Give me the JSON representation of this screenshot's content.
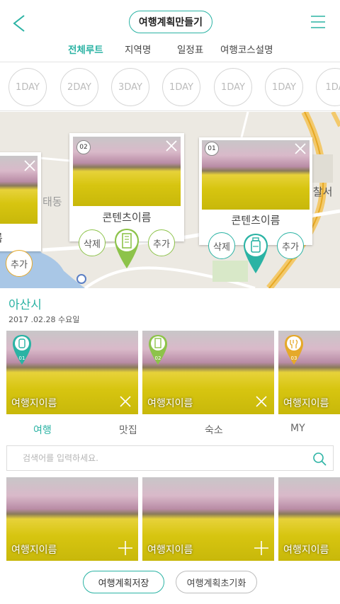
{
  "header": {
    "title": "여행계획만들기",
    "back_icon": "chevron-left-icon",
    "menu_icon": "hamburger-menu-icon",
    "accent_color": "#2bb3a4"
  },
  "subtabs": [
    {
      "label": "전체루트",
      "active": true
    },
    {
      "label": "지역명",
      "active": false
    },
    {
      "label": "일정표",
      "active": false
    },
    {
      "label": "여행코스설명",
      "active": false
    }
  ],
  "days": [
    "1DAY",
    "2DAY",
    "3DAY",
    "1DAY",
    "1DAY",
    "1DAY",
    "1DA"
  ],
  "map": {
    "place_labels": [
      "경찰서",
      "태동"
    ],
    "cards": [
      {
        "number": "",
        "name": "름",
        "add_label": "추가"
      },
      {
        "number": "02",
        "name": "콘텐츠이름",
        "delete_label": "삭제",
        "add_label": "추가",
        "pin_icon": "building-icon",
        "pin_color": "#8dc34a"
      },
      {
        "number": "01",
        "name": "콘텐츠이름",
        "delete_label": "삭제",
        "add_label": "추가",
        "pin_icon": "bottle-icon",
        "pin_color": "#2bb3a4"
      }
    ]
  },
  "region": {
    "city": "아산시",
    "date": "2017 .02.28  수요일"
  },
  "selected_items": [
    {
      "name": "여행지이름",
      "marker": "01",
      "marker_icon": "bottle-icon",
      "action_icon": "close-icon"
    },
    {
      "name": "여행지이름",
      "marker": "02",
      "marker_icon": "building-icon",
      "action_icon": "close-icon"
    },
    {
      "name": "여행지이름",
      "marker": "03",
      "marker_icon": "restaurant-icon",
      "action_icon": "close-icon"
    }
  ],
  "category_tabs": [
    {
      "label": "여행",
      "active": true
    },
    {
      "label": "맛집",
      "active": false
    },
    {
      "label": "숙소",
      "active": false
    },
    {
      "label": "MY",
      "active": false
    }
  ],
  "search": {
    "placeholder": "검색어를 입력하세요.",
    "value": "",
    "icon": "search-icon"
  },
  "results": [
    {
      "name": "여행지이름",
      "action_icon": "plus-icon"
    },
    {
      "name": "여행지이름",
      "action_icon": "plus-icon"
    },
    {
      "name": "여행지이름",
      "action_icon": "plus-icon"
    }
  ],
  "footer": {
    "save_label": "여행계획저장",
    "reset_label": "여행계획초기화"
  }
}
